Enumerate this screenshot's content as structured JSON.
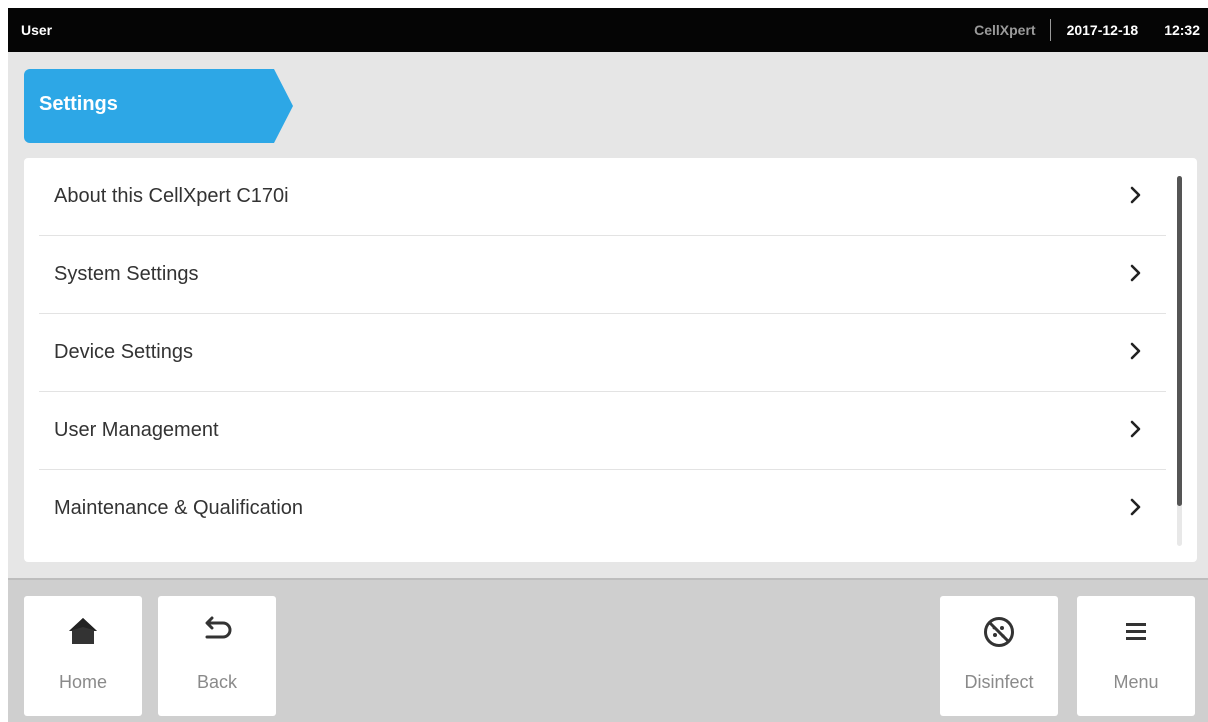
{
  "status_bar": {
    "user": "User",
    "device_name": "CellXpert",
    "date": "2017-12-18",
    "time": "12:32"
  },
  "breadcrumb": {
    "label": "Settings"
  },
  "settings_list": [
    {
      "label": "About this CellXpert C170i",
      "icon": "chevron-right-icon"
    },
    {
      "label": "System Settings",
      "icon": "chevron-right-icon"
    },
    {
      "label": "Device Settings",
      "icon": "chevron-right-icon"
    },
    {
      "label": "User Management",
      "icon": "chevron-right-icon"
    },
    {
      "label": "Maintenance & Qualification",
      "icon": "chevron-right-icon"
    }
  ],
  "bottom_nav": {
    "home": {
      "label": "Home",
      "icon": "home-icon"
    },
    "back": {
      "label": "Back",
      "icon": "back-arrow-icon"
    },
    "disinfect": {
      "label": "Disinfect",
      "icon": "disinfect-icon"
    },
    "menu": {
      "label": "Menu",
      "icon": "hamburger-menu-icon"
    }
  },
  "colors": {
    "status_bar_bg": "#050505",
    "accent": "#2da7e6",
    "background": "#e6e6e6",
    "bottom_bar_bg": "#cfcfcf",
    "text": "#333333"
  }
}
